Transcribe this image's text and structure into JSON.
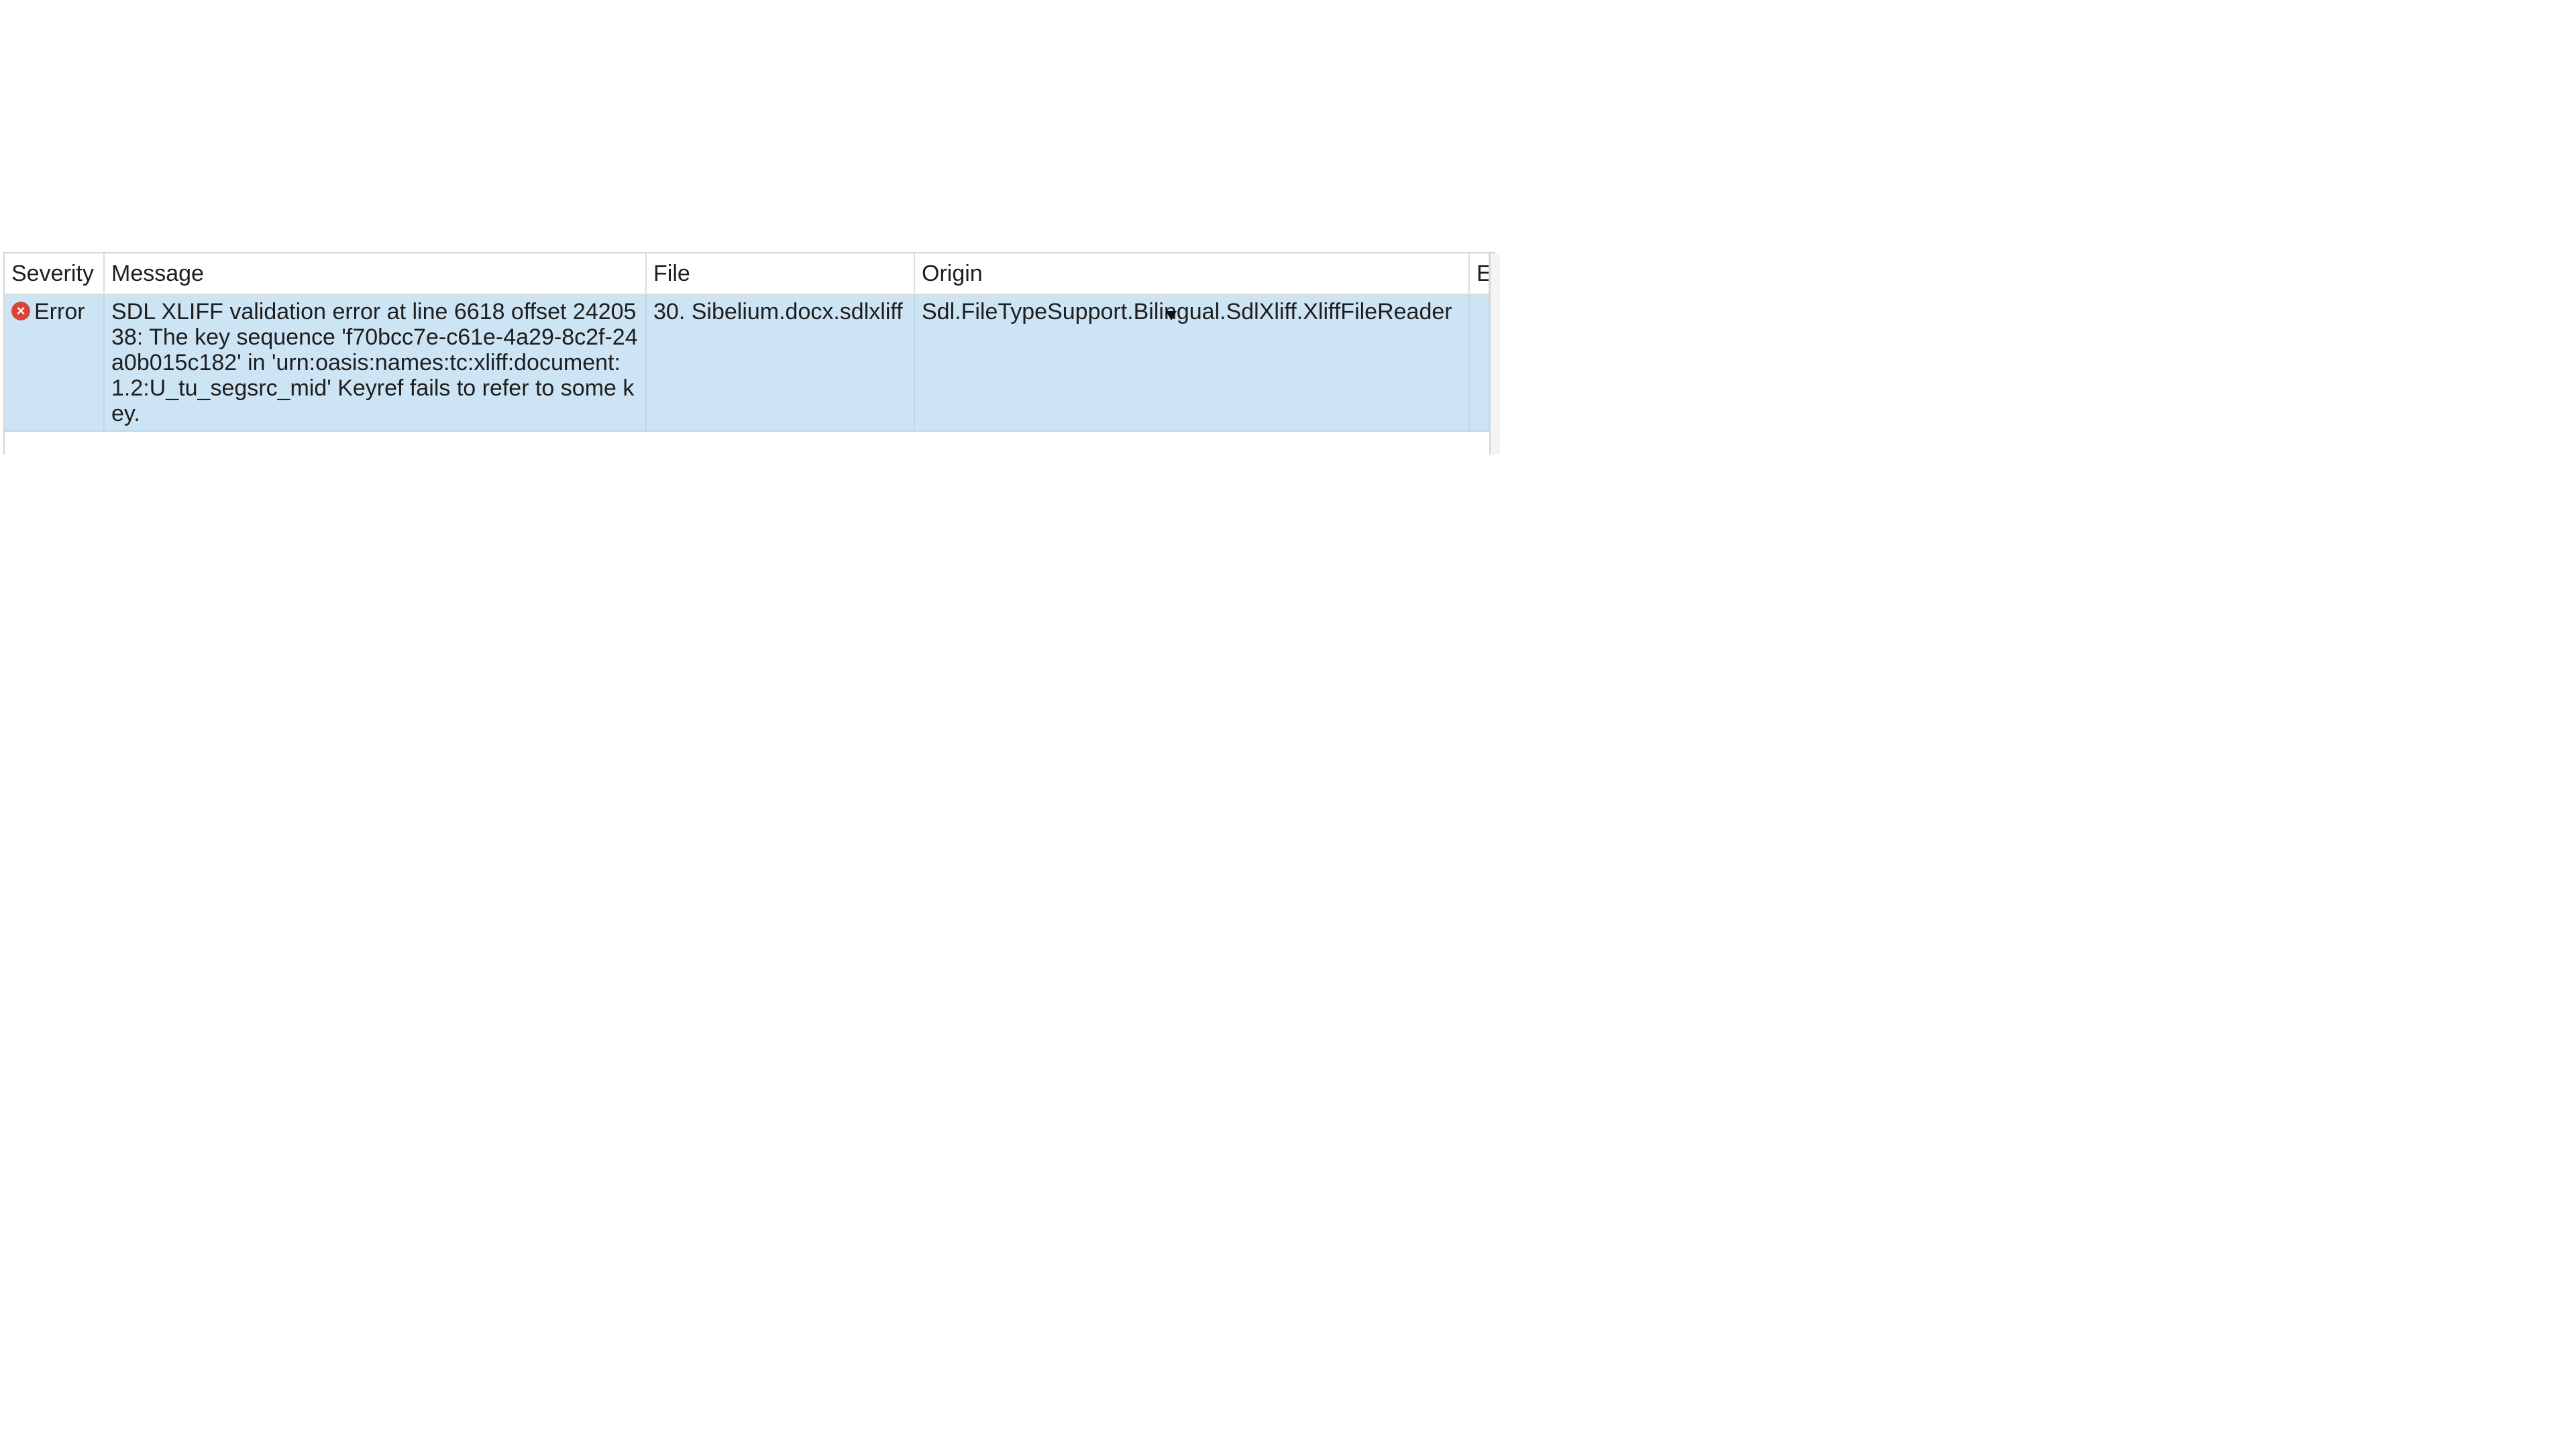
{
  "columns": {
    "severity": "Severity",
    "message": "Message",
    "file": "File",
    "origin": "Origin",
    "extra": "E"
  },
  "rows": [
    {
      "severity_icon": "error-icon",
      "severity": "Error",
      "message": "SDL XLIFF validation error at line 6618 offset 2420538: The key sequence 'f70bcc7e-c61e-4a29-8c2f-24a0b015c182' in 'urn:oasis:names:tc:xliff:document:1.2:U_tu_segsrc_mid' Keyref fails to refer to some key.",
      "file": "30. Sibelium.docx.sdlxliff",
      "origin": "Sdl.FileTypeSupport.Bilingual.SdlXliff.XliffFileReader",
      "extra": ""
    }
  ],
  "colors": {
    "selected_row": "#cde4f5",
    "error_icon": "#d9433b"
  }
}
